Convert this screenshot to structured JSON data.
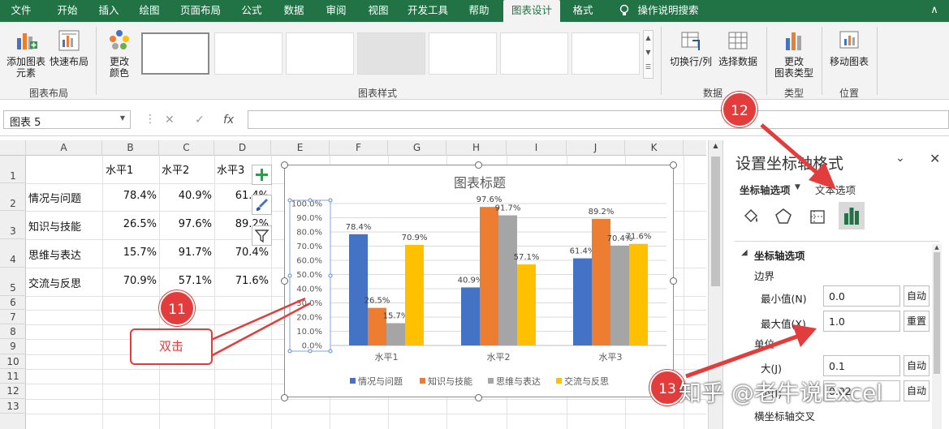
{
  "tabs": [
    "文件",
    "开始",
    "插入",
    "绘图",
    "页面布局",
    "公式",
    "数据",
    "审阅",
    "视图",
    "开发工具",
    "帮助",
    "图表设计",
    "格式",
    "操作说明搜索"
  ],
  "ribbon": {
    "add_chart_element": "添加图表\n元素",
    "quick_layout": "快速布局",
    "change_colors": "更改\n颜色",
    "group_layout": "图表布局",
    "group_styles": "图表样式",
    "switch_row_col": "切换行/列",
    "select_data": "选择数据",
    "group_data": "数据",
    "change_type": "更改\n图表类型",
    "group_type": "类型",
    "move_chart": "移动图表",
    "group_location": "位置"
  },
  "formula_bar": {
    "name_box": "图表 5",
    "cancel": "✕",
    "enter": "✓",
    "fx": "fx",
    "value": ""
  },
  "columns": [
    "A",
    "B",
    "C",
    "D",
    "E",
    "F",
    "G",
    "H",
    "I",
    "J",
    "K"
  ],
  "rows": [
    "1",
    "2",
    "3",
    "4",
    "5",
    "6",
    "7",
    "8",
    "9",
    "10",
    "11",
    "12",
    "13"
  ],
  "table": {
    "header": [
      "水平1",
      "水平2",
      "水平3"
    ],
    "rows": [
      {
        "label": "情况与问题",
        "v": [
          "78.4%",
          "40.9%",
          "61.4%"
        ]
      },
      {
        "label": "知识与技能",
        "v": [
          "26.5%",
          "97.6%",
          "89.2%"
        ]
      },
      {
        "label": "思维与表达",
        "v": [
          "15.7%",
          "91.7%",
          "70.4%"
        ]
      },
      {
        "label": "交流与反思",
        "v": [
          "70.9%",
          "57.1%",
          "71.6%"
        ]
      }
    ]
  },
  "chart_data": {
    "type": "bar",
    "title": "图表标题",
    "categories": [
      "水平1",
      "水平2",
      "水平3"
    ],
    "series": [
      {
        "name": "情况与问题",
        "values": [
          78.4,
          40.9,
          61.4
        ],
        "labels": [
          "78.4%",
          "40.9%",
          "61.4%"
        ],
        "color": "#4472c4"
      },
      {
        "name": "知识与技能",
        "values": [
          26.5,
          97.6,
          89.2
        ],
        "labels": [
          "26.5%",
          "97.6%",
          "89.2%"
        ],
        "color": "#ed7d31"
      },
      {
        "name": "思维与表达",
        "values": [
          15.7,
          91.7,
          70.4
        ],
        "labels": [
          "15.7%",
          "91.7%",
          "70.4%"
        ],
        "color": "#a5a5a5"
      },
      {
        "name": "交流与反思",
        "values": [
          70.9,
          57.1,
          71.6
        ],
        "labels": [
          "70.9%",
          "57.1%",
          "71.6%"
        ],
        "color": "#ffc000"
      }
    ],
    "ylim": [
      0,
      100
    ],
    "yticks": [
      "0.0%",
      "10.0%",
      "20.0%",
      "30.0%",
      "40.0%",
      "50.0%",
      "60.0%",
      "70.0%",
      "80.0%",
      "90.0%",
      "100.0%"
    ],
    "grid": true,
    "legend": "bottom"
  },
  "pane": {
    "title": "设置坐标轴格式",
    "axis_options": "坐标轴选项",
    "text_options": "文本选项",
    "section": "坐标轴选项",
    "bounds": "边界",
    "min_label": "最小值(N)",
    "min_value": "0.0",
    "min_btn": "自动",
    "max_label": "最大值(X)",
    "max_value": "1.0",
    "max_btn": "重置",
    "units": "单位",
    "major_label": "大(J)",
    "major_value": "0.1",
    "major_btn": "自动",
    "minor_label": "小(I)",
    "minor_value": "0.02",
    "minor_btn": "自动",
    "cross": "横坐标轴交叉"
  },
  "annotations": {
    "n11": "11",
    "n12": "12",
    "n13": "13",
    "dblclick": "双击"
  },
  "watermark": "知乎 @老牛说Excel",
  "colors": {
    "excel_green": "#217346",
    "callout_red": "#e23c3c"
  }
}
